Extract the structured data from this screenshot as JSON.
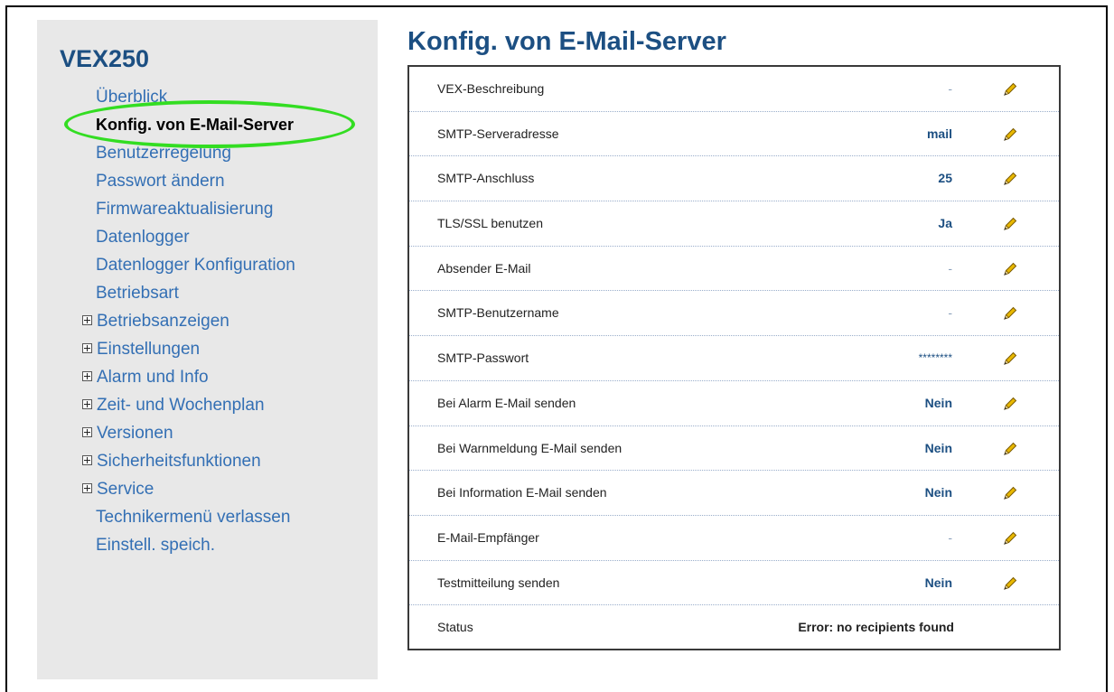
{
  "sidebar": {
    "brand": "VEX250",
    "items": [
      {
        "label": "Überblick",
        "expandable": false,
        "active": false
      },
      {
        "label": "Konfig. von E-Mail-Server",
        "expandable": false,
        "active": true
      },
      {
        "label": "Benutzerregelung",
        "expandable": false,
        "active": false
      },
      {
        "label": "Passwort ändern",
        "expandable": false,
        "active": false
      },
      {
        "label": "Firmwareaktualisierung",
        "expandable": false,
        "active": false
      },
      {
        "label": "Datenlogger",
        "expandable": false,
        "active": false
      },
      {
        "label": "Datenlogger Konfiguration",
        "expandable": false,
        "active": false
      },
      {
        "label": "Betriebsart",
        "expandable": false,
        "active": false
      },
      {
        "label": "Betriebsanzeigen",
        "expandable": true,
        "active": false
      },
      {
        "label": "Einstellungen",
        "expandable": true,
        "active": false
      },
      {
        "label": "Alarm und Info",
        "expandable": true,
        "active": false
      },
      {
        "label": "Zeit- und Wochenplan",
        "expandable": true,
        "active": false
      },
      {
        "label": "Versionen",
        "expandable": true,
        "active": false
      },
      {
        "label": "Sicherheitsfunktionen",
        "expandable": true,
        "active": false
      },
      {
        "label": "Service",
        "expandable": true,
        "active": false
      },
      {
        "label": "Technikermenü verlassen",
        "expandable": false,
        "active": false
      },
      {
        "label": "Einstell. speich.",
        "expandable": false,
        "active": false
      }
    ]
  },
  "main": {
    "title": "Konfig. von E-Mail-Server",
    "rows": [
      {
        "label": "VEX-Beschreibung",
        "value": "-",
        "style": "dim",
        "editable": true
      },
      {
        "label": "SMTP-Serveradresse",
        "value": "mail",
        "style": "",
        "editable": true
      },
      {
        "label": "SMTP-Anschluss",
        "value": "25",
        "style": "",
        "editable": true
      },
      {
        "label": "TLS/SSL benutzen",
        "value": "Ja",
        "style": "",
        "editable": true
      },
      {
        "label": "Absender E-Mail",
        "value": "-",
        "style": "dim",
        "editable": true
      },
      {
        "label": "SMTP-Benutzername",
        "value": "-",
        "style": "dim",
        "editable": true
      },
      {
        "label": "SMTP-Passwort",
        "value": "********",
        "style": "stars",
        "editable": true
      },
      {
        "label": "Bei Alarm E-Mail senden",
        "value": "Nein",
        "style": "",
        "editable": true
      },
      {
        "label": "Bei Warnmeldung E-Mail senden",
        "value": "Nein",
        "style": "",
        "editable": true
      },
      {
        "label": "Bei Information E-Mail senden",
        "value": "Nein",
        "style": "",
        "editable": true
      },
      {
        "label": "E-Mail-Empfänger",
        "value": "-",
        "style": "dim",
        "editable": true
      },
      {
        "label": "Testmitteilung senden",
        "value": "Nein",
        "style": "",
        "editable": true
      },
      {
        "label": "Status",
        "value": "Error: no recipients found",
        "style": "status",
        "editable": false
      }
    ]
  },
  "icons": {
    "expand": "plus-box-icon",
    "edit": "pencil-icon"
  },
  "colors": {
    "brand": "#1c4f82",
    "link": "#336fb4",
    "sidebar_bg": "#e8e8e8",
    "highlight": "#33dd22",
    "pencil": "#e8b800"
  }
}
